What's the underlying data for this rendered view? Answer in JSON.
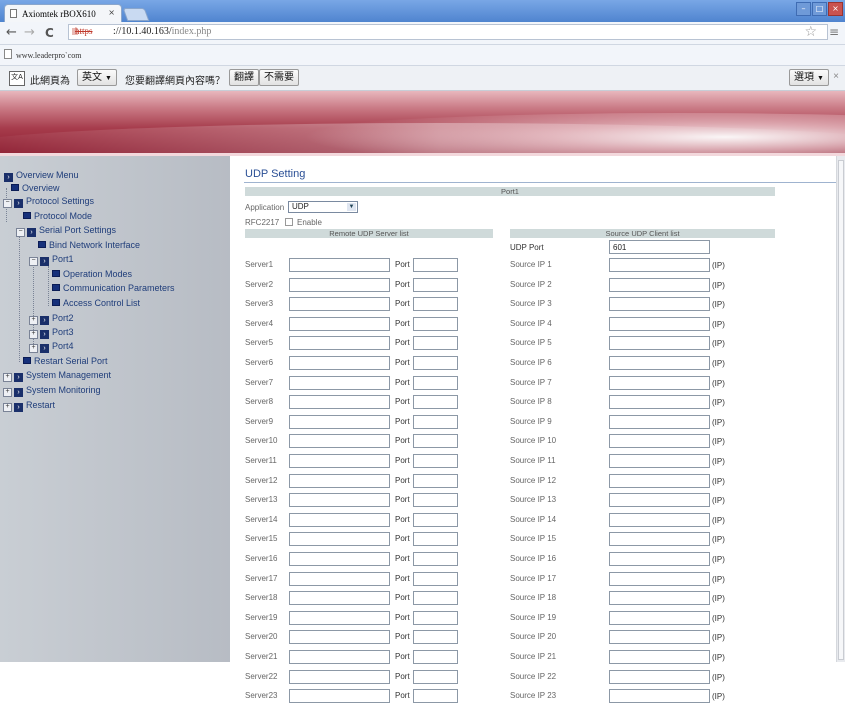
{
  "browser": {
    "tab_title": "Axiomtek rBOX610",
    "tab_close": "×",
    "url_scheme": "https",
    "url_host": "://10.1.40.163/",
    "url_path": "index.php",
    "bookmark": "www.leaderpro`com",
    "nav_back": "←",
    "nav_forward": "→",
    "nav_reload": "C",
    "star": "☆",
    "menu": "≡",
    "win_min": "–",
    "win_max": "□",
    "win_close": "×"
  },
  "translate_bar": {
    "icon": "文A",
    "prompt_prefix": "此網頁為",
    "language": "英文",
    "prompt_suffix": "您要翻譯網頁內容嗎？",
    "translate_button": "翻譯",
    "nope_button": "不需要",
    "options_button": "選項",
    "close": "×"
  },
  "sidebar": {
    "overview_menu": "Overview Menu",
    "overview": "Overview",
    "protocol_settings": "Protocol Settings",
    "protocol_mode": "Protocol Mode",
    "serial_port_settings": "Serial Port Settings",
    "bind_network_interface": "Bind Network Interface",
    "port1": "Port1",
    "operation_modes": "Operation Modes",
    "communication_parameters": "Communication Parameters",
    "access_control_list": "Access Control List",
    "port2": "Port2",
    "port3": "Port3",
    "port4": "Port4",
    "restart_serial_port": "Restart Serial Port",
    "system_management": "System Management",
    "system_monitoring": "System Monitoring",
    "restart": "Restart"
  },
  "main": {
    "title": "UDP Setting",
    "port_header": "Port1",
    "application_label": "Application",
    "application_value": "UDP",
    "rfc_label": "RFC2217",
    "enable_label": "Enable",
    "remote_header": "Remote UDP Server list",
    "source_header": "Source UDP Client list",
    "udp_port_label": "UDP Port",
    "udp_port_value": "601",
    "port_label": "Port",
    "ip_suffix": "(IP)",
    "rows": [
      {
        "server": "Server1",
        "source": "Source IP 1"
      },
      {
        "server": "Server2",
        "source": "Source IP 2"
      },
      {
        "server": "Server3",
        "source": "Source IP 3"
      },
      {
        "server": "Server4",
        "source": "Source IP 4"
      },
      {
        "server": "Server5",
        "source": "Source IP 5"
      },
      {
        "server": "Server6",
        "source": "Source IP 6"
      },
      {
        "server": "Server7",
        "source": "Source IP 7"
      },
      {
        "server": "Server8",
        "source": "Source IP 8"
      },
      {
        "server": "Server9",
        "source": "Source IP 9"
      },
      {
        "server": "Server10",
        "source": "Source IP 10"
      },
      {
        "server": "Server11",
        "source": "Source IP 11"
      },
      {
        "server": "Server12",
        "source": "Source IP 12"
      },
      {
        "server": "Server13",
        "source": "Source IP 13"
      },
      {
        "server": "Server14",
        "source": "Source IP 14"
      },
      {
        "server": "Server15",
        "source": "Source IP 15"
      },
      {
        "server": "Server16",
        "source": "Source IP 16"
      },
      {
        "server": "Server17",
        "source": "Source IP 17"
      },
      {
        "server": "Server18",
        "source": "Source IP 18"
      },
      {
        "server": "Server19",
        "source": "Source IP 19"
      },
      {
        "server": "Server20",
        "source": "Source IP 20"
      },
      {
        "server": "Server21",
        "source": "Source IP 21"
      },
      {
        "server": "Server22",
        "source": "Source IP 22"
      },
      {
        "server": "Server23",
        "source": "Source IP 23"
      }
    ]
  }
}
